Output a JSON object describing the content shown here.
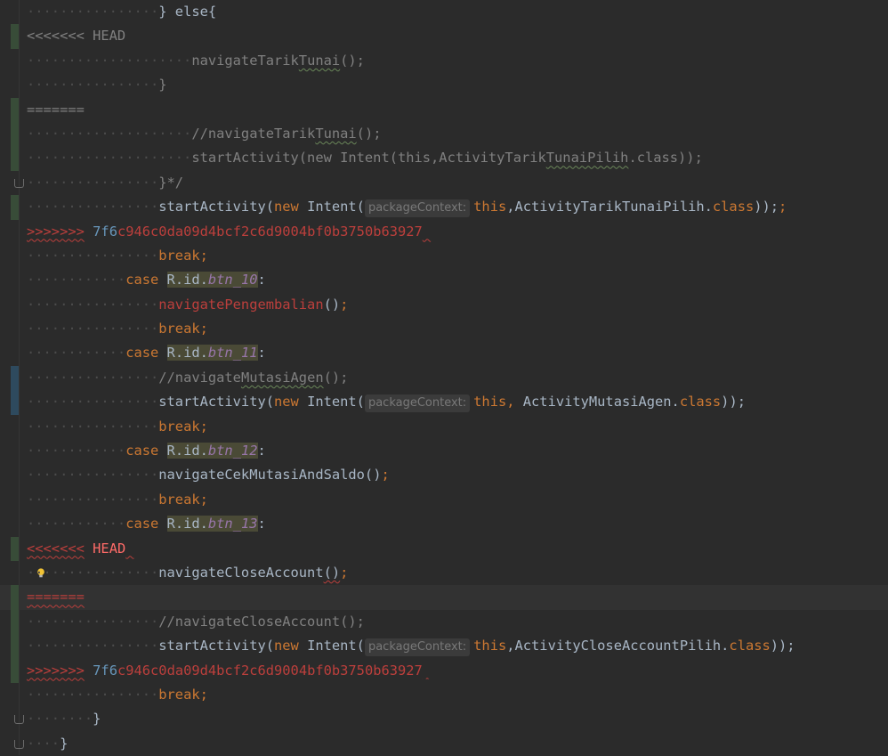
{
  "editor": {
    "lines": [
      {
        "indent": 16,
        "tokens": [
          {
            "t": "} else{",
            "c": "punc"
          }
        ]
      },
      {
        "indent": 0,
        "marker": "green",
        "tokens": [
          {
            "t": "<<<<<<< HEAD",
            "c": "cm"
          }
        ]
      },
      {
        "indent": 20,
        "tokens": [
          {
            "t": "navigateTarik",
            "c": "cm"
          },
          {
            "t": "Tunai",
            "c": "cm squig-g"
          },
          {
            "t": "();",
            "c": "cm"
          }
        ]
      },
      {
        "indent": 16,
        "tokens": [
          {
            "t": "}",
            "c": "cm"
          }
        ]
      },
      {
        "indent": 0,
        "marker": "green",
        "tokens": [
          {
            "t": "=======",
            "c": "cm"
          }
        ]
      },
      {
        "indent": 20,
        "marker": "green",
        "tokens": [
          {
            "t": "//navigateTarik",
            "c": "cm"
          },
          {
            "t": "Tunai",
            "c": "cm squig-g"
          },
          {
            "t": "();",
            "c": "cm"
          }
        ]
      },
      {
        "indent": 20,
        "marker": "green",
        "tokens": [
          {
            "t": "startActivity(new Intent(this,ActivityTarik",
            "c": "cm"
          },
          {
            "t": "TunaiPilih",
            "c": "cm squig-g"
          },
          {
            "t": ".class));",
            "c": "cm"
          }
        ]
      },
      {
        "indent": 16,
        "fold": true,
        "tokens": [
          {
            "t": "}*/",
            "c": "cm"
          }
        ]
      },
      {
        "indent": 16,
        "marker": "green",
        "tokens": [
          {
            "t": "startActivity(",
            "c": "punc"
          },
          {
            "t": "new ",
            "c": "kw"
          },
          {
            "t": "Intent(",
            "c": "punc"
          },
          {
            "t": "packageContext:",
            "c": "hint"
          },
          {
            "t": "this",
            "c": "kw"
          },
          {
            "t": ",ActivityTarikTunaiPilih.",
            "c": "punc"
          },
          {
            "t": "class",
            "c": "kw"
          },
          {
            "t": "));",
            "c": "punc"
          },
          {
            "t": ";",
            "c": "kw"
          }
        ]
      },
      {
        "indent": 0,
        "tokens": [
          {
            "t": ">>>>>>>",
            "c": "err squig"
          },
          {
            "t": " ",
            "c": "punc"
          },
          {
            "t": "7f6",
            "c": "hash"
          },
          {
            "t": "c946c0da09d4bcf2c6d9004bf0b3750b63927",
            "c": "err"
          },
          {
            "t": " ",
            "c": "squig"
          }
        ]
      },
      {
        "indent": 16,
        "tokens": [
          {
            "t": "break;",
            "c": "kw"
          }
        ]
      },
      {
        "indent": 12,
        "tokens": [
          {
            "t": "case ",
            "c": "kw"
          },
          {
            "t": "R.id.",
            "c": "punc hl"
          },
          {
            "t": "btn_10",
            "c": "fld hl"
          },
          {
            "t": ":",
            "c": "punc"
          }
        ]
      },
      {
        "indent": 16,
        "tokens": [
          {
            "t": "navigatePengembalian",
            "c": "err"
          },
          {
            "t": "()",
            "c": "punc"
          },
          {
            "t": ";",
            "c": "kw"
          }
        ]
      },
      {
        "indent": 16,
        "tokens": [
          {
            "t": "break;",
            "c": "kw"
          }
        ]
      },
      {
        "indent": 12,
        "tokens": [
          {
            "t": "case ",
            "c": "kw"
          },
          {
            "t": "R.id.",
            "c": "punc hl"
          },
          {
            "t": "btn_11",
            "c": "fld hl"
          },
          {
            "t": ":",
            "c": "punc"
          }
        ]
      },
      {
        "indent": 16,
        "marker": "blue",
        "tokens": [
          {
            "t": "//navigate",
            "c": "cm"
          },
          {
            "t": "MutasiAgen",
            "c": "cm squig-g"
          },
          {
            "t": "();",
            "c": "cm"
          }
        ]
      },
      {
        "indent": 16,
        "marker": "blue",
        "tokens": [
          {
            "t": "startActivity(",
            "c": "punc"
          },
          {
            "t": "new ",
            "c": "kw"
          },
          {
            "t": "Intent(",
            "c": "punc"
          },
          {
            "t": "packageContext:",
            "c": "hint"
          },
          {
            "t": "this, ",
            "c": "kw"
          },
          {
            "t": "ActivityMutasiAgen.",
            "c": "punc"
          },
          {
            "t": "class",
            "c": "kw"
          },
          {
            "t": "));",
            "c": "punc"
          }
        ]
      },
      {
        "indent": 16,
        "tokens": [
          {
            "t": "break;",
            "c": "kw"
          }
        ]
      },
      {
        "indent": 12,
        "tokens": [
          {
            "t": "case ",
            "c": "kw"
          },
          {
            "t": "R.id.",
            "c": "punc hl"
          },
          {
            "t": "btn_12",
            "c": "fld hl"
          },
          {
            "t": ":",
            "c": "punc"
          }
        ]
      },
      {
        "indent": 16,
        "tokens": [
          {
            "t": "navigateCekMutasiAndSaldo",
            "c": "punc"
          },
          {
            "t": "()",
            "c": "punc"
          },
          {
            "t": ";",
            "c": "kw"
          }
        ]
      },
      {
        "indent": 16,
        "tokens": [
          {
            "t": "break;",
            "c": "kw"
          }
        ]
      },
      {
        "indent": 12,
        "tokens": [
          {
            "t": "case ",
            "c": "kw"
          },
          {
            "t": "R.id.",
            "c": "punc hl"
          },
          {
            "t": "btn_13",
            "c": "fld hl"
          },
          {
            "t": ":",
            "c": "punc"
          }
        ]
      },
      {
        "indent": 0,
        "marker": "green",
        "tokens": [
          {
            "t": "<<<<<<<",
            "c": "err squig"
          },
          {
            "t": " ",
            "c": "punc"
          },
          {
            "t": "HEAD",
            "c": "red"
          },
          {
            "t": " ",
            "c": "squig"
          }
        ]
      },
      {
        "indent": 16,
        "bulb": true,
        "tokens": [
          {
            "t": "navigateCloseAccount",
            "c": "punc"
          },
          {
            "t": "()",
            "c": "punc squig"
          },
          {
            "t": ";",
            "c": "kw"
          }
        ]
      },
      {
        "indent": 0,
        "marker": "green",
        "current": true,
        "tokens": [
          {
            "t": "=======",
            "c": "err squig"
          }
        ]
      },
      {
        "indent": 16,
        "marker": "green",
        "tokens": [
          {
            "t": "//navigateCloseAccount();",
            "c": "cm"
          }
        ]
      },
      {
        "indent": 16,
        "marker": "green",
        "tokens": [
          {
            "t": "startActivity(",
            "c": "punc"
          },
          {
            "t": "new ",
            "c": "kw"
          },
          {
            "t": "Intent(",
            "c": "punc"
          },
          {
            "t": "packageContext:",
            "c": "hint"
          },
          {
            "t": "this",
            "c": "kw"
          },
          {
            "t": ",ActivityCloseAccountPilih.",
            "c": "punc"
          },
          {
            "t": "class",
            "c": "kw"
          },
          {
            "t": "));",
            "c": "punc"
          }
        ]
      },
      {
        "indent": 0,
        "marker": "green",
        "tokens": [
          {
            "t": ">>>>>>>",
            "c": "err squig"
          },
          {
            "t": " ",
            "c": "punc"
          },
          {
            "t": "7f6",
            "c": "hash"
          },
          {
            "t": "c946c0da09d4bcf2c6d9004bf0b3750b63927",
            "c": "err"
          },
          {
            "t": " ",
            "c": "squig"
          }
        ]
      },
      {
        "indent": 16,
        "tokens": [
          {
            "t": "break;",
            "c": "kw"
          }
        ]
      },
      {
        "indent": 8,
        "fold": true,
        "tokens": [
          {
            "t": "}",
            "c": "punc"
          }
        ]
      },
      {
        "indent": 4,
        "fold": true,
        "tokens": [
          {
            "t": "}",
            "c": "punc"
          }
        ]
      }
    ],
    "colors": {
      "background": "#2b2b2b",
      "keyword": "#cc7832",
      "comment": "#808080",
      "field": "#9876aa",
      "error": "#bc3f3c",
      "number": "#6897bb"
    },
    "icons": [
      "lightbulb-icon",
      "fold-marker-icon"
    ]
  }
}
